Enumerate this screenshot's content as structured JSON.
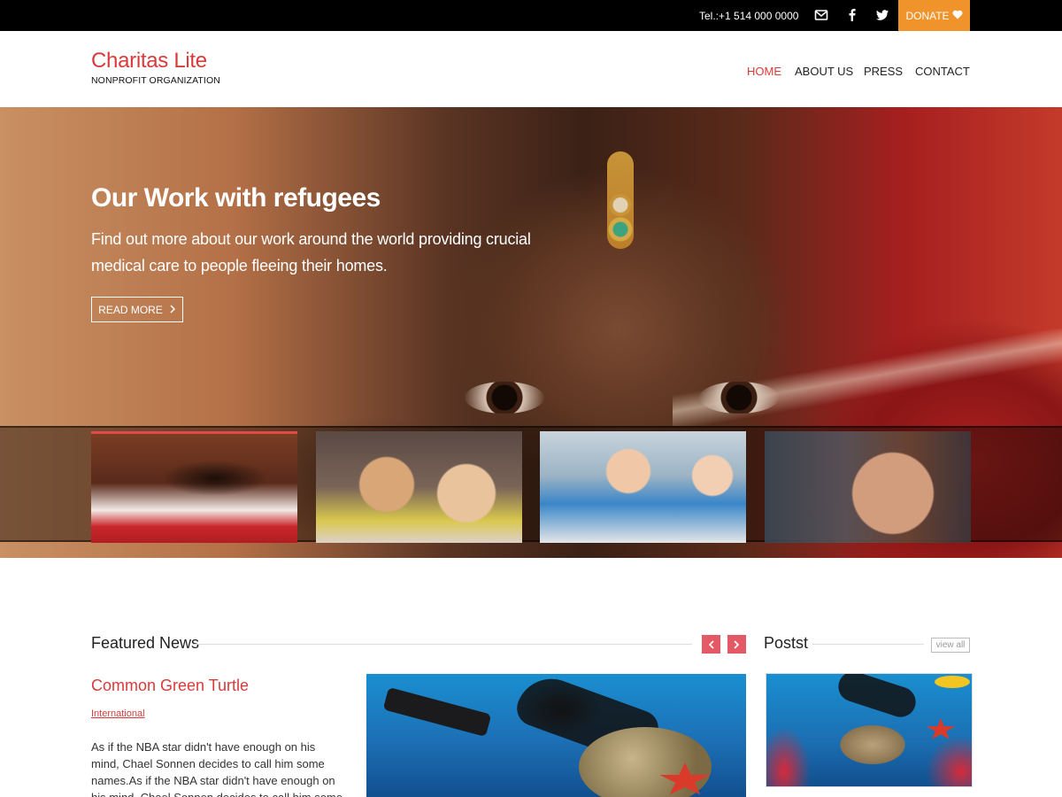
{
  "topbar": {
    "tel": "Tel.:+1 514 000 0000",
    "donate_label": "DONATE",
    "icons": [
      "mail-icon",
      "facebook-icon",
      "twitter-icon",
      "heart-icon"
    ],
    "accent": "#f0932b"
  },
  "header": {
    "site_title": "Charitas Lite",
    "tagline": "NONPROFIT ORGANIZATION",
    "brand_color": "#d93a3a",
    "nav": [
      {
        "label": "HOME",
        "active": true
      },
      {
        "label": "ABOUT US",
        "active": false
      },
      {
        "label": "PRESS",
        "active": false
      },
      {
        "label": "CONTACT",
        "active": false
      }
    ]
  },
  "hero": {
    "title": "Our Work with refugees",
    "text": "Find out more about our work around the world providing crucial medical care to people fleeing their homes.",
    "button_label": "READ MORE",
    "button_icon": "chevron-right-icon"
  },
  "featured": {
    "section_title": "Featured News",
    "prev_icon": "chevron-left-icon",
    "next_icon": "chevron-right-icon",
    "article": {
      "title": "Common Green Turtle",
      "category": "International",
      "excerpt": "As if the NBA star didn't have enough on his mind, Chael Sonnen decides to call him some names.As if the NBA star didn't have enough on his mind, Chael Sonnen decides to call him some"
    }
  },
  "posts": {
    "section_title": "Postst",
    "view_all_label": "view all"
  }
}
